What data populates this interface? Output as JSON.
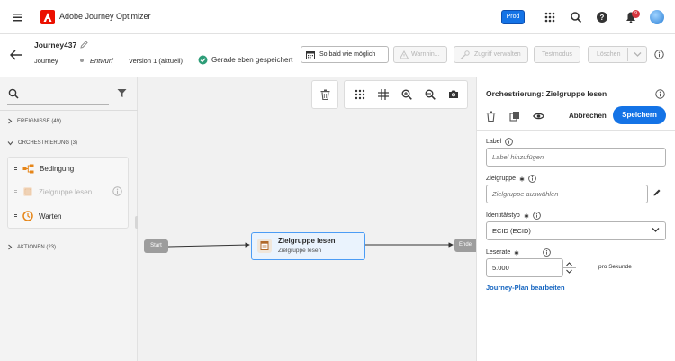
{
  "app": {
    "title": "Adobe Journey Optimizer",
    "env_badge": "Prod",
    "notification_count": "9"
  },
  "journey": {
    "name": "Journey437",
    "type": "Journey",
    "status": "Entwurf",
    "version": "Version 1 (aktuell)",
    "saved_text": "Gerade eben gespeichert"
  },
  "header_buttons": {
    "schedule": "So bald wie möglich",
    "warnings": "Warnhin...",
    "access": "Zugriff verwalten",
    "testmode": "Testmodus",
    "delete": "Löschen"
  },
  "palette": {
    "events": "EREIGNISSE (49)",
    "orchestration": "ORCHESTRIERUNG (3)",
    "orchestration_items": [
      "Bedingung",
      "Zielgruppe lesen",
      "Warten"
    ],
    "actions": "AKTIONEN (23)"
  },
  "canvas": {
    "start": "Start",
    "end": "Ende",
    "activity_title": "Zielgruppe lesen",
    "activity_subtitle": "Zielgruppe lesen"
  },
  "panel": {
    "title": "Orchestrierung: Zielgruppe lesen",
    "cancel": "Abbrechen",
    "save": "Speichern",
    "label_label": "Label",
    "label_placeholder": "Label hinzufügen",
    "audience_label": "Zielgruppe",
    "audience_placeholder": "Zielgruppe auswählen",
    "idtype_label": "Identitätstyp",
    "idtype_value": "ECID (ECID)",
    "rate_label": "Leserate",
    "rate_value": "5.000",
    "rate_unit": "pro Sekunde",
    "plan_link": "Journey-Plan bearbeiten"
  },
  "colors": {
    "accent": "#1473e6",
    "adobe_red": "#eb1000",
    "saved_green": "#2d9d78",
    "node_border": "#4b9cf5"
  }
}
